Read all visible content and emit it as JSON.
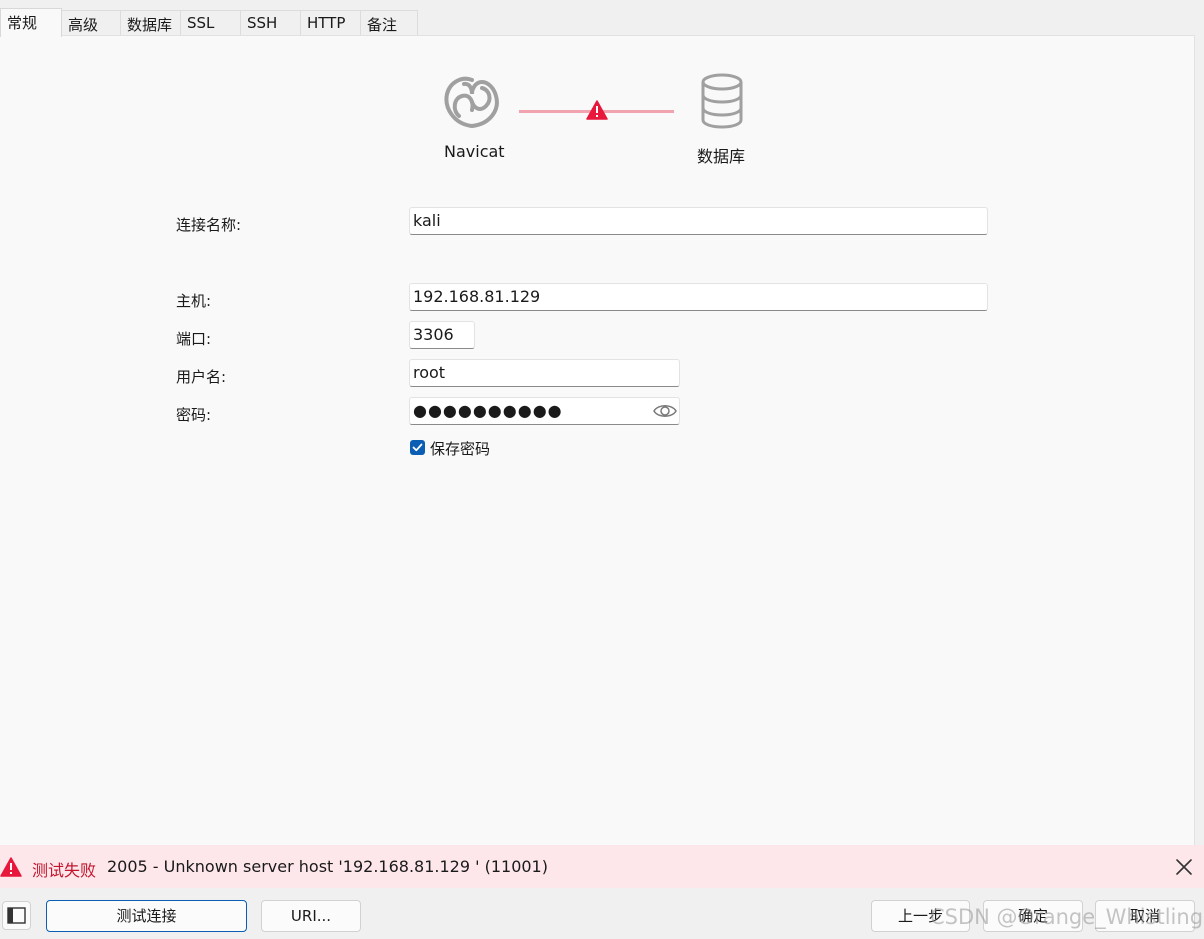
{
  "tabs": [
    {
      "label": "常规",
      "active": true
    },
    {
      "label": "高级"
    },
    {
      "label": "数据库"
    },
    {
      "label": "SSL"
    },
    {
      "label": "SSH"
    },
    {
      "label": "HTTP"
    },
    {
      "label": "备注"
    }
  ],
  "diagram": {
    "left_label": "Navicat",
    "right_label": "数据库",
    "status": "error"
  },
  "form": {
    "connection_name": {
      "label": "连接名称:",
      "value": "kali"
    },
    "host": {
      "label": "主机:",
      "value": "192.168.81.129"
    },
    "port": {
      "label": "端口:",
      "value": "3306"
    },
    "username": {
      "label": "用户名:",
      "value": "root"
    },
    "password": {
      "label": "密码:",
      "value": "●●●●●●●●●●"
    },
    "save_password": {
      "label": "保存密码",
      "checked": true
    }
  },
  "error_bar": {
    "title": "测试失败",
    "message": "2005 - Unknown server host '192.168.81.129 ' (11001)"
  },
  "buttons": {
    "test_connection": "测试连接",
    "uri": "URI...",
    "prev": "上一步",
    "ok": "确定",
    "cancel": "取消"
  },
  "watermark": "CSDN @Orange_Whistling",
  "colors": {
    "accent": "#0a5fb4",
    "error": "#e8173c",
    "error_bg": "#fde7ea",
    "link_line": "#f2a3b0"
  }
}
